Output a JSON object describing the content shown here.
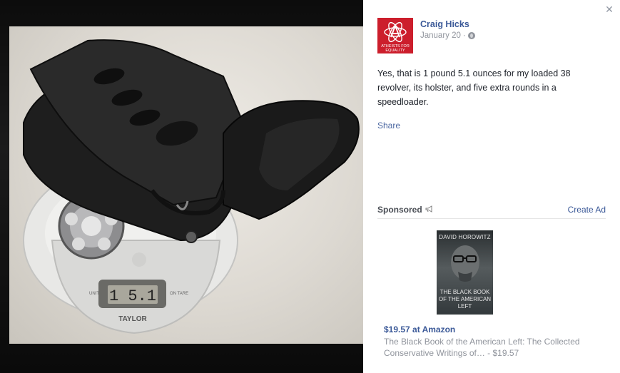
{
  "post": {
    "author": "Craig Hicks",
    "date": "January 20",
    "date_separator": "·",
    "privacy_icon": "globe-icon",
    "text": "Yes, that is 1 pound 5.1 ounces for my loaded 38 revolver, its holster, and five extra rounds in a speedloader.",
    "share_label": "Share",
    "avatar_text": "ATHEISTS FOR EQUALITY"
  },
  "photo": {
    "scale_display": "1 5.1",
    "scale_brand": "TAYLOR",
    "scale_left_button": "UNIT",
    "scale_right_button": "ON TARE"
  },
  "sponsored": {
    "label": "Sponsored",
    "create_ad_label": "Create Ad",
    "book_author": "DAVID HOROWITZ",
    "book_title": "THE BLACK BOOK OF THE AMERICAN LEFT",
    "price_line": "$19.57 at Amazon",
    "description": "The Black Book of the American Left: The Collected Conservative Writings of… - $19.57"
  },
  "close_icon": "close-icon",
  "colors": {
    "link": "#3b5998",
    "avatar_bg": "#cc1e2c",
    "muted": "#90949c"
  }
}
